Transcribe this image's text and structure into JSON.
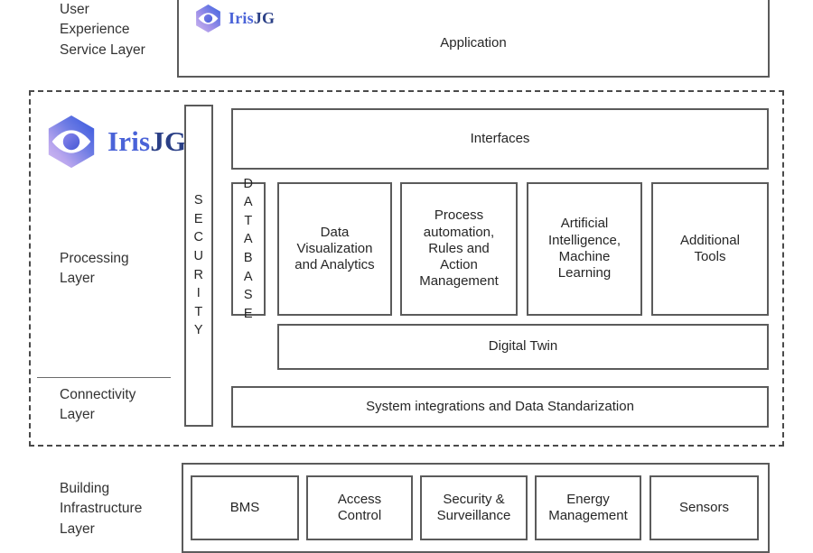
{
  "brand": {
    "name_primary": "Iris",
    "name_secondary": "JG",
    "logo_icon": "iris-eye-hexagon-logo",
    "color_primary": "#4a63d8",
    "color_secondary": "#2a3f86",
    "hex_gradient_from": "#c9b4ee",
    "hex_gradient_to": "#3a62e0"
  },
  "layers": {
    "user_experience": {
      "label": "User\nExperience\nService Layer",
      "application_box": "Application"
    },
    "processing": {
      "label": "Processing\nLayer",
      "security_column": "SECURITY",
      "security_letters": [
        "S",
        "E",
        "C",
        "U",
        "R",
        "I",
        "T",
        "Y"
      ],
      "database_column": "DATABASE",
      "database_letters": [
        "D",
        "A",
        "T",
        "A",
        "B",
        "A",
        "S",
        "E"
      ],
      "interfaces_box": "Interfaces",
      "modules": [
        "Data\nVisualization\nand Analytics",
        "Process\nautomation,\nRules and\nAction\nManagement",
        "Artificial\nIntelligence,\nMachine\nLearning",
        "Additional\nTools"
      ],
      "digital_twin_box": "Digital Twin"
    },
    "connectivity": {
      "label": "Connectivity\nLayer",
      "integration_box": "System integrations and Data Standarization"
    },
    "building_infrastructure": {
      "label": "Building\nInfrastructure\nLayer",
      "components": [
        "BMS",
        "Access\nControl",
        "Security &\nSurveillance",
        "Energy\nManagement",
        "Sensors"
      ]
    }
  }
}
